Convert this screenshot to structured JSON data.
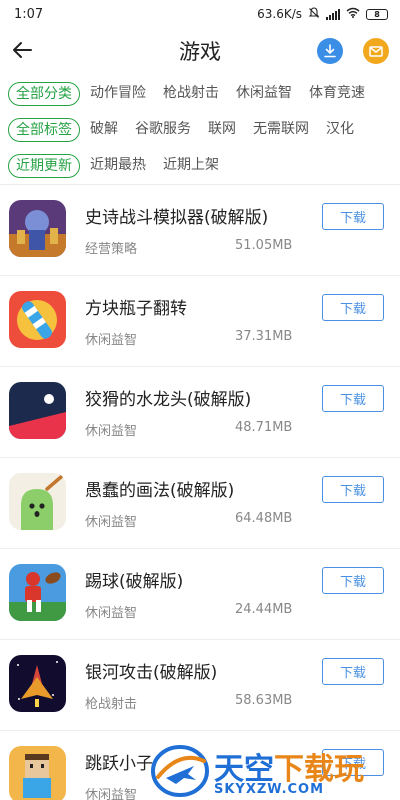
{
  "status_bar": {
    "time": "1:07",
    "net_speed": "63.6K/s",
    "battery": "8"
  },
  "header": {
    "title": "游戏",
    "back_icon": "back-arrow-icon",
    "download_icon": "download-icon",
    "mail_icon": "mail-icon",
    "download_color": "#3a8ee6",
    "mail_color": "#f2a81d"
  },
  "filters": {
    "category": [
      {
        "label": "全部分类",
        "active": true
      },
      {
        "label": "动作冒险",
        "active": false
      },
      {
        "label": "枪战射击",
        "active": false
      },
      {
        "label": "休闲益智",
        "active": false
      },
      {
        "label": "体育竞速",
        "active": false
      }
    ],
    "tags": [
      {
        "label": "全部标签",
        "active": true
      },
      {
        "label": "破解",
        "active": false
      },
      {
        "label": "谷歌服务",
        "active": false
      },
      {
        "label": "联网",
        "active": false
      },
      {
        "label": "无需联网",
        "active": false
      },
      {
        "label": "汉化",
        "active": false
      }
    ],
    "sort": [
      {
        "label": "近期更新",
        "active": true
      },
      {
        "label": "近期最热",
        "active": false
      },
      {
        "label": "近期上架",
        "active": false
      }
    ],
    "accent_color": "#25a244"
  },
  "apps": [
    {
      "name": "史诗战斗模拟器(破解版)",
      "category": "经营策略",
      "size": "51.05MB",
      "button": "下载",
      "icon": "epic-battle-icon"
    },
    {
      "name": "方块瓶子翻转",
      "category": "休闲益智",
      "size": "37.31MB",
      "button": "下载",
      "icon": "bottle-flip-icon"
    },
    {
      "name": "狡猾的水龙头(破解版)",
      "category": "休闲益智",
      "size": "48.71MB",
      "button": "下载",
      "icon": "faucet-icon"
    },
    {
      "name": "愚蠢的画法(破解版)",
      "category": "休闲益智",
      "size": "64.48MB",
      "button": "下载",
      "icon": "drawing-blob-icon"
    },
    {
      "name": "踢球(破解版)",
      "category": "休闲益智",
      "size": "24.44MB",
      "button": "下载",
      "icon": "football-icon"
    },
    {
      "name": "银河攻击(破解版)",
      "category": "枪战射击",
      "size": "58.63MB",
      "button": "下载",
      "icon": "galaxy-attack-icon"
    },
    {
      "name": "跳跃小子",
      "category": "休闲益智",
      "size": "",
      "button": "下载",
      "icon": "jump-kid-icon"
    }
  ],
  "watermark": {
    "cn_part1": "天空",
    "cn_part2": "下载玩",
    "url": "SKYXZW.COM",
    "logo": "skyxzw-logo"
  }
}
